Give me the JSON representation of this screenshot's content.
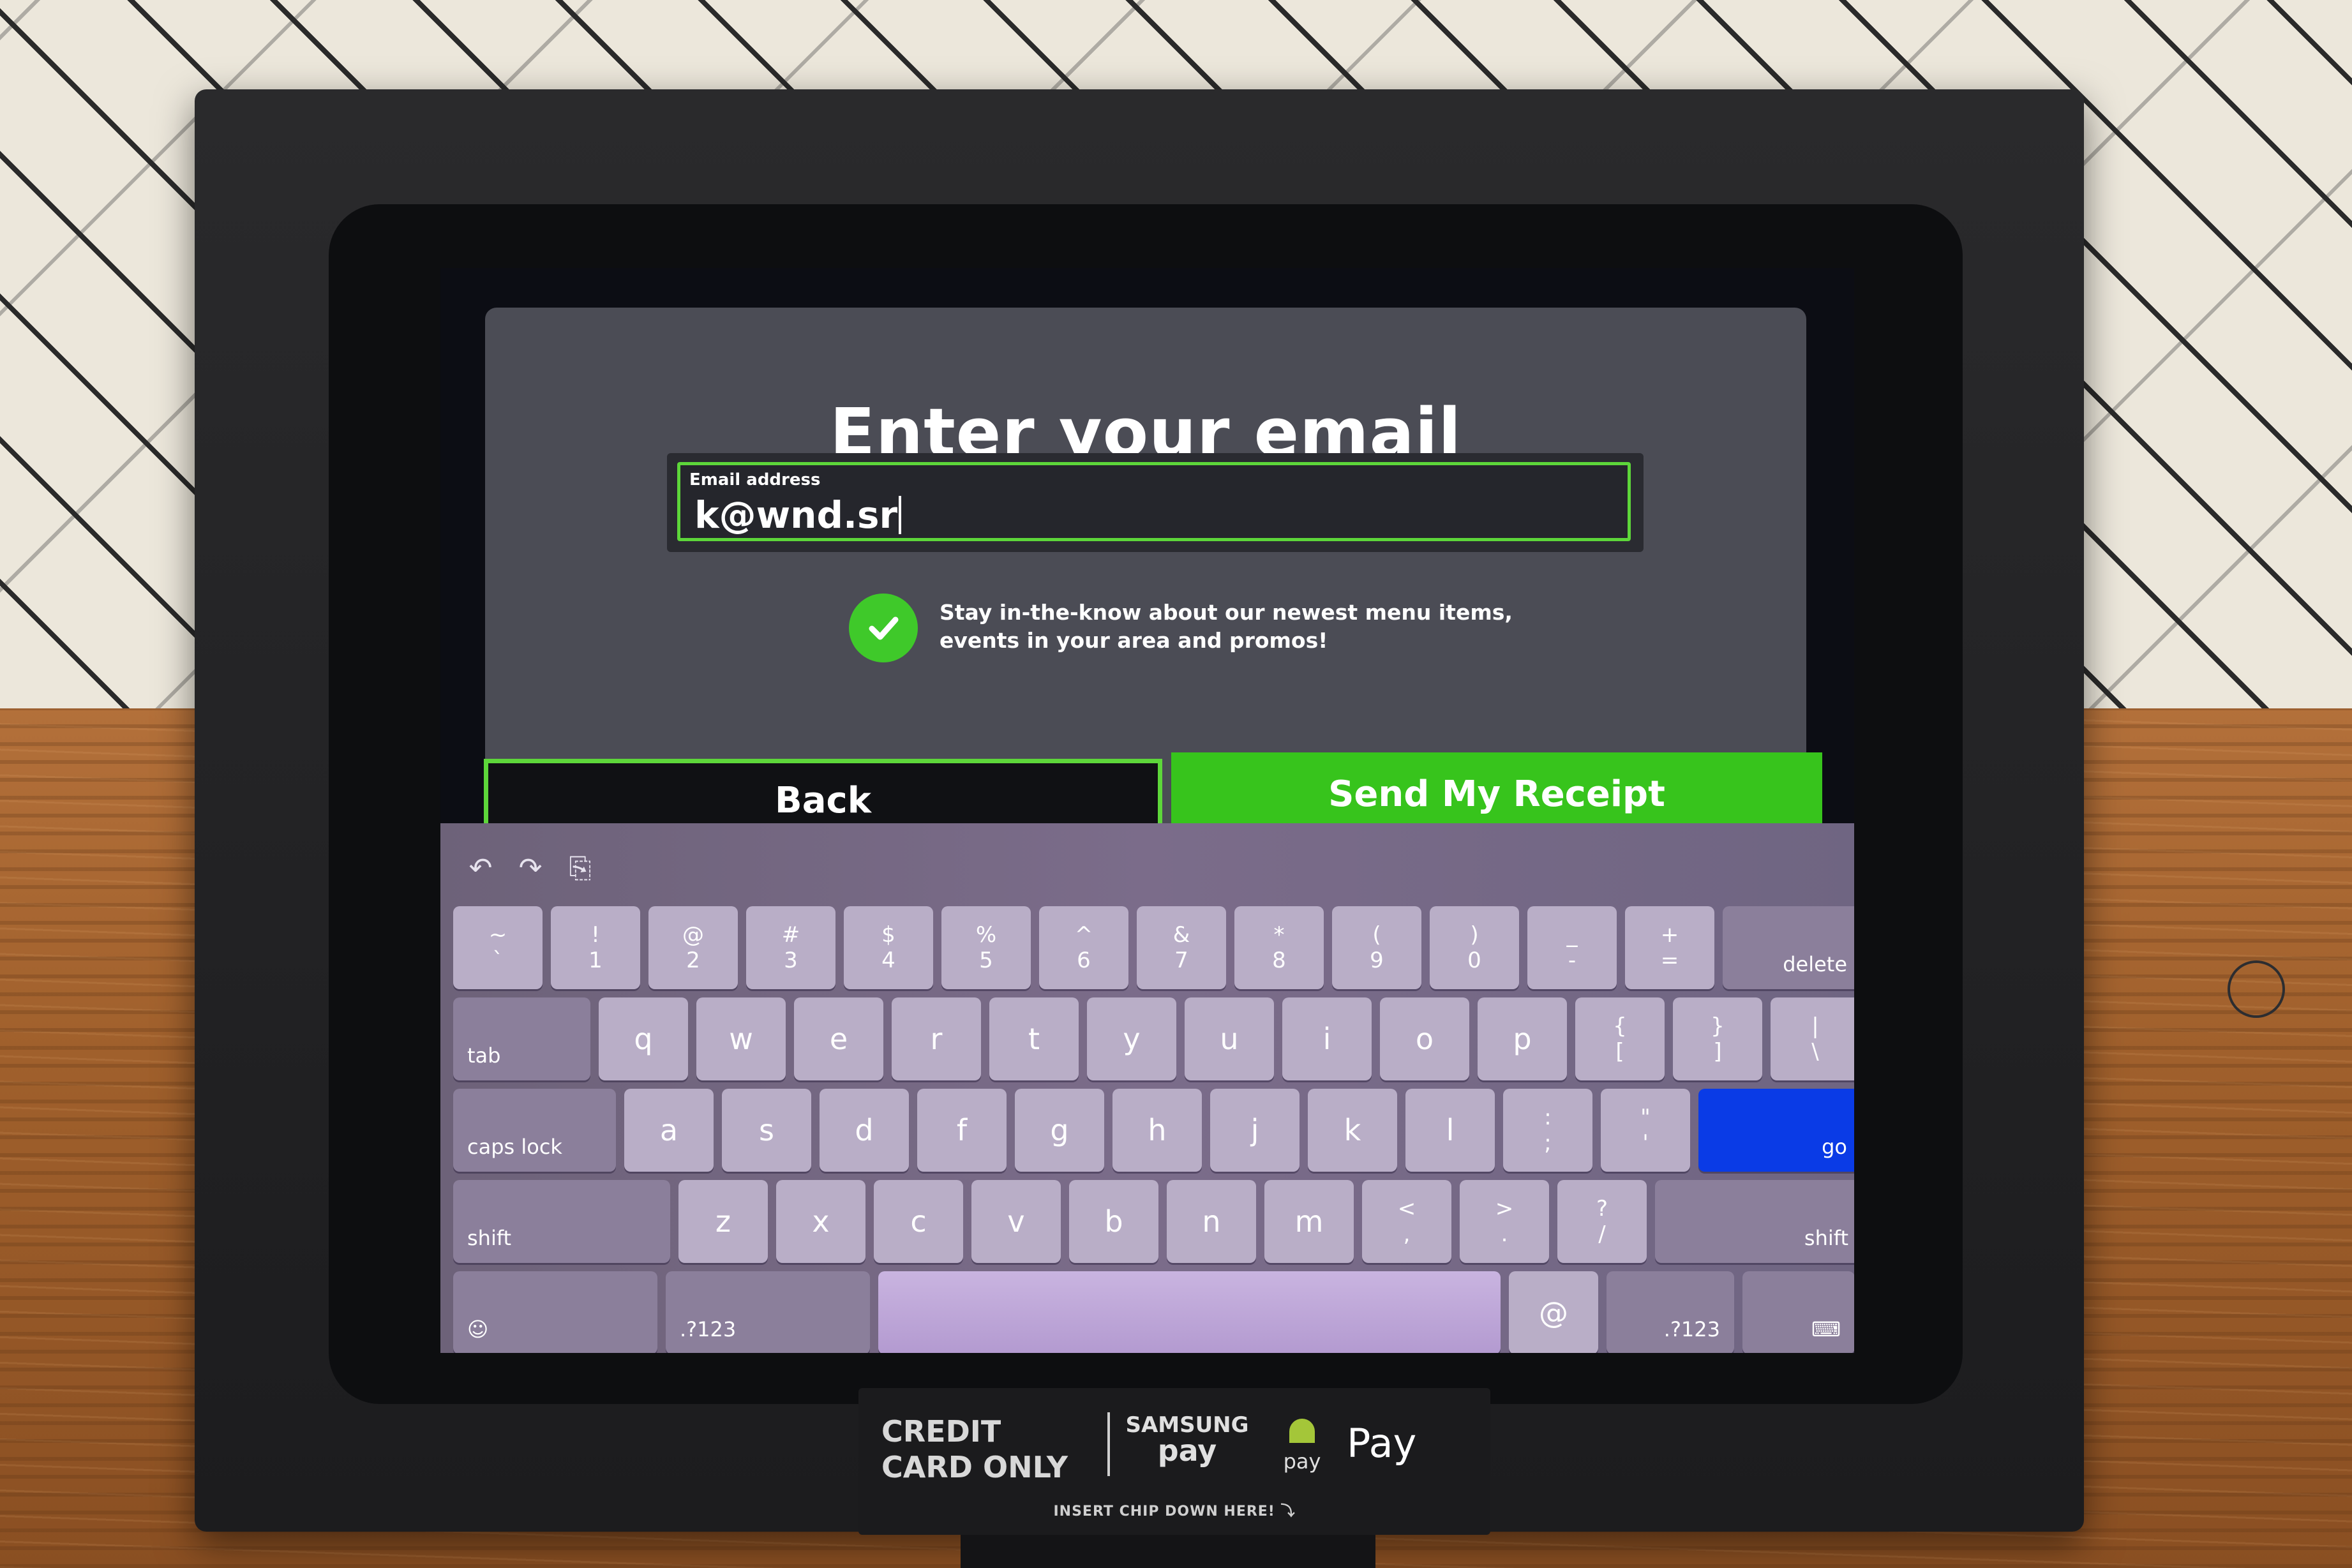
{
  "screen": {
    "title": "Enter your email",
    "email": {
      "label": "Email address",
      "value": "k@wnd.sr"
    },
    "optin": {
      "checked": true,
      "text_line1": "Stay in-the-know about our newest menu items,",
      "text_line2": "events in your area and promos!"
    },
    "buttons": {
      "back": "Back",
      "send": "Send My Receipt"
    }
  },
  "keyboard": {
    "toolbar": [
      {
        "name": "undo-icon",
        "glyph": "↶"
      },
      {
        "name": "redo-icon",
        "glyph": "↷"
      },
      {
        "name": "paste-icon",
        "glyph": "⎘"
      }
    ],
    "row1": [
      {
        "top": "~",
        "bottom": "`"
      },
      {
        "top": "!",
        "bottom": "1"
      },
      {
        "top": "@",
        "bottom": "2"
      },
      {
        "top": "#",
        "bottom": "3"
      },
      {
        "top": "$",
        "bottom": "4"
      },
      {
        "top": "%",
        "bottom": "5"
      },
      {
        "top": "^",
        "bottom": "6"
      },
      {
        "top": "&",
        "bottom": "7"
      },
      {
        "top": "*",
        "bottom": "8"
      },
      {
        "top": "(",
        "bottom": "9"
      },
      {
        "top": ")",
        "bottom": "0"
      },
      {
        "top": "_",
        "bottom": "-"
      },
      {
        "top": "+",
        "bottom": "="
      }
    ],
    "delete_label": "delete",
    "tab_label": "tab",
    "row2": [
      "q",
      "w",
      "e",
      "r",
      "t",
      "y",
      "u",
      "i",
      "o",
      "p"
    ],
    "row2_symbols": [
      {
        "top": "{",
        "bottom": "["
      },
      {
        "top": "}",
        "bottom": "]"
      },
      {
        "top": "|",
        "bottom": "\\"
      }
    ],
    "caps_label": "caps lock",
    "row3": [
      "a",
      "s",
      "d",
      "f",
      "g",
      "h",
      "j",
      "k",
      "l"
    ],
    "row3_symbols": [
      {
        "top": ":",
        "bottom": ";"
      },
      {
        "top": "\"",
        "bottom": "'"
      }
    ],
    "go_label": "go",
    "shift_label": "shift",
    "row4": [
      "z",
      "x",
      "c",
      "v",
      "b",
      "n",
      "m"
    ],
    "row4_symbols": [
      {
        "top": "<",
        "bottom": ","
      },
      {
        "top": ">",
        "bottom": "."
      },
      {
        "top": "?",
        "bottom": "/"
      }
    ],
    "numbers_label": ".?123",
    "at_label": "@",
    "emoji_glyph": "☺",
    "hide_keyboard_glyph": "⌨"
  },
  "reader": {
    "credit_card_only": "CREDIT CARD ONLY",
    "samsung_line1": "SAMSUNG",
    "samsung_line2": "pay",
    "android_line": "pay",
    "apple_pay": " Pay",
    "insert_chip": "INSERT CHIP DOWN HERE! ⤵"
  },
  "colors": {
    "accent_green": "#3fc92a",
    "go_blue": "#0a3be6",
    "dialog_gray": "#4b4c55"
  }
}
